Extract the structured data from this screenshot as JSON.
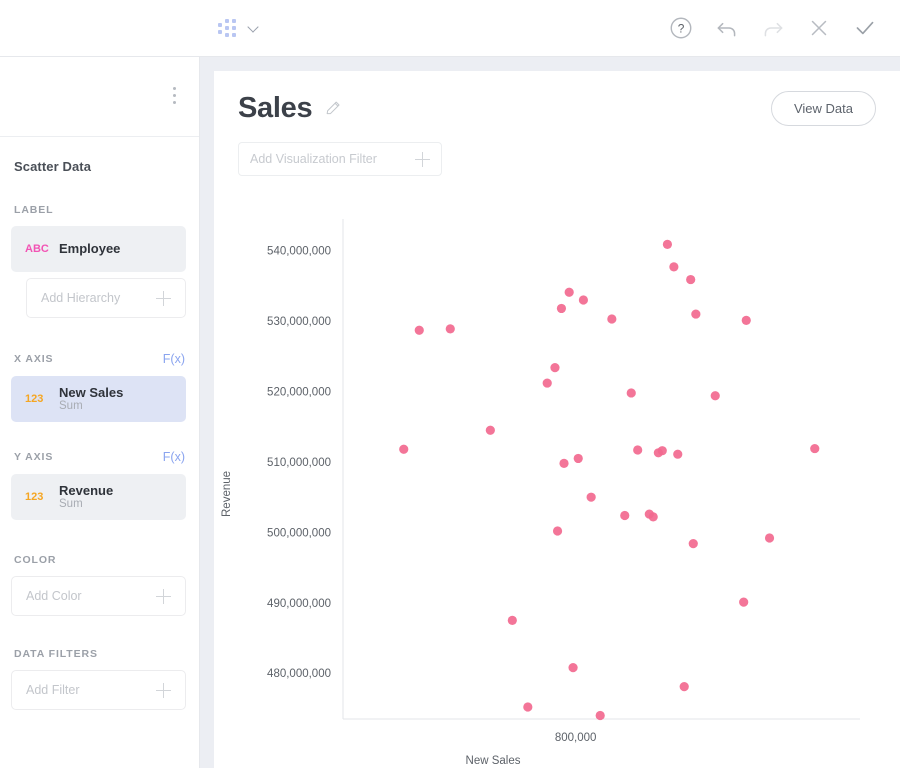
{
  "topbar": {
    "logo_name": "domo-logo",
    "dropdown_icon": "chevron-down-icon",
    "icons": [
      {
        "name": "help-icon",
        "label": "Help"
      },
      {
        "name": "undo-icon",
        "label": "Undo"
      },
      {
        "name": "redo-icon",
        "label": "Redo"
      },
      {
        "name": "close-icon",
        "label": "Close"
      },
      {
        "name": "confirm-check-icon",
        "label": "Save"
      }
    ]
  },
  "sidebar": {
    "kebab_icon": "more-options-icon",
    "dataset_title": "Scatter Data",
    "sections": {
      "label": {
        "heading": "LABEL",
        "field": {
          "type": "ABC",
          "name": "Employee",
          "sub": ""
        },
        "hierarchy_placeholder": "Add Hierarchy"
      },
      "x_axis": {
        "heading": "X AXIS",
        "fx": "F(x)",
        "field": {
          "type": "123",
          "name": "New Sales",
          "sub": "Sum"
        }
      },
      "y_axis": {
        "heading": "Y AXIS",
        "fx": "F(x)",
        "field": {
          "type": "123",
          "name": "Revenue",
          "sub": "Sum"
        }
      },
      "color": {
        "heading": "COLOR",
        "placeholder": "Add Color"
      },
      "data_filters": {
        "heading": "DATA FILTERS",
        "placeholder": "Add Filter"
      }
    }
  },
  "main": {
    "title": "Sales",
    "edit_icon": "pencil-icon",
    "view_data_label": "View Data",
    "viz_filter_placeholder": "Add Visualization Filter"
  },
  "colors": {
    "point": "#f2698f",
    "accent_blue": "#8aa4ef",
    "abc_pink": "#f254b4",
    "num_orange": "#f5a623",
    "selected_field_bg": "#dde3f5",
    "field_bg": "#eef0f3",
    "canvas_bg": "#eceef3"
  },
  "chart_data": {
    "type": "scatter",
    "title": "Sales",
    "xlabel": "New Sales",
    "ylabel": "Revenue",
    "grid": false,
    "legend": null,
    "ytick_labels": [
      "540,000,000",
      "530,000,000",
      "520,000,000",
      "510,000,000",
      "500,000,000",
      "490,000,000",
      "480,000,000"
    ],
    "yticks": [
      540000000,
      530000000,
      520000000,
      510000000,
      500000000,
      490000000,
      480000000
    ],
    "xtick_labels": [
      "800,000"
    ],
    "xticks": [
      800000
    ],
    "ylim": [
      473500000,
      544500000
    ],
    "xlim": [
      620000,
      1020000
    ],
    "series_name": "Employee",
    "points": [
      {
        "x": 667000,
        "y": 511800000
      },
      {
        "x": 679000,
        "y": 528700000
      },
      {
        "x": 703000,
        "y": 528900000
      },
      {
        "x": 734000,
        "y": 514500000
      },
      {
        "x": 751000,
        "y": 487500000
      },
      {
        "x": 763000,
        "y": 475200000
      },
      {
        "x": 778000,
        "y": 521200000
      },
      {
        "x": 784000,
        "y": 523400000
      },
      {
        "x": 786000,
        "y": 500200000
      },
      {
        "x": 789000,
        "y": 531800000
      },
      {
        "x": 791000,
        "y": 509800000
      },
      {
        "x": 795000,
        "y": 534100000
      },
      {
        "x": 798000,
        "y": 480800000
      },
      {
        "x": 802000,
        "y": 510500000
      },
      {
        "x": 806000,
        "y": 533000000
      },
      {
        "x": 812000,
        "y": 505000000
      },
      {
        "x": 819000,
        "y": 474000000
      },
      {
        "x": 828000,
        "y": 530300000
      },
      {
        "x": 838000,
        "y": 502400000
      },
      {
        "x": 843000,
        "y": 519800000
      },
      {
        "x": 848000,
        "y": 511700000
      },
      {
        "x": 857000,
        "y": 502600000
      },
      {
        "x": 860000,
        "y": 502200000
      },
      {
        "x": 864000,
        "y": 511300000
      },
      {
        "x": 867000,
        "y": 511600000
      },
      {
        "x": 871000,
        "y": 540900000
      },
      {
        "x": 876000,
        "y": 537700000
      },
      {
        "x": 879000,
        "y": 511100000
      },
      {
        "x": 884000,
        "y": 478100000
      },
      {
        "x": 889000,
        "y": 535900000
      },
      {
        "x": 891000,
        "y": 498400000
      },
      {
        "x": 893000,
        "y": 531000000
      },
      {
        "x": 908000,
        "y": 519400000
      },
      {
        "x": 930000,
        "y": 490100000
      },
      {
        "x": 932000,
        "y": 530100000
      },
      {
        "x": 950000,
        "y": 499200000
      },
      {
        "x": 985000,
        "y": 511900000
      }
    ]
  }
}
